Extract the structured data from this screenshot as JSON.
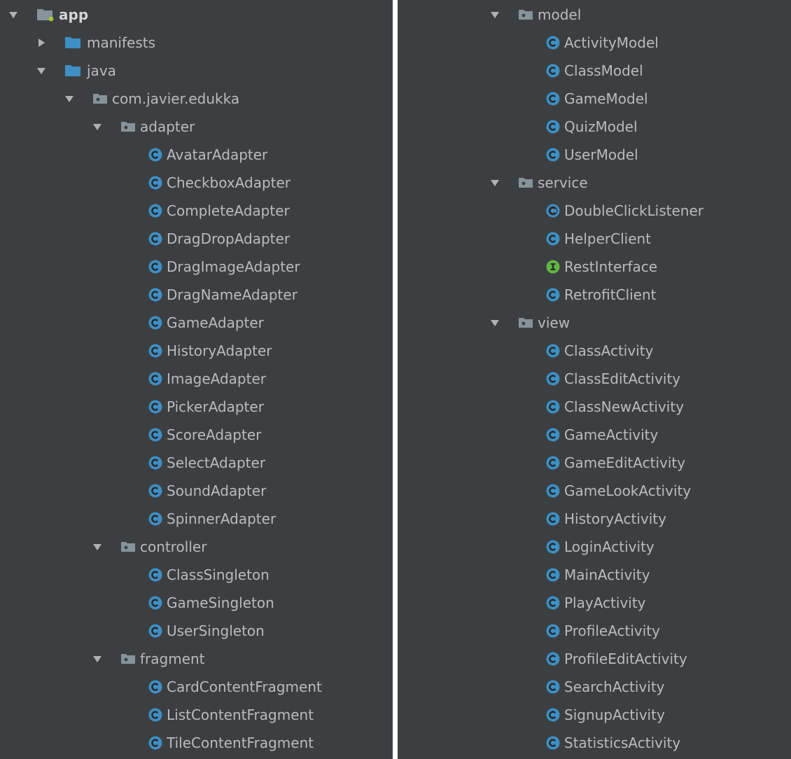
{
  "colors": {
    "background": "#3c3f41",
    "text": "#bbbbbb",
    "folder": "#87939a",
    "source_folder": "#3d8fc6",
    "class_icon": "#3d8fc6",
    "interface_icon": "#62b543",
    "module_dot": "#a4c639",
    "arrow": "#afb1b3"
  },
  "left_tree": [
    {
      "depth": 0,
      "arrow": "down",
      "icon": "module-folder-icon",
      "label": "app",
      "bold": true
    },
    {
      "depth": 1,
      "arrow": "right",
      "icon": "source-folder-icon",
      "label": "manifests"
    },
    {
      "depth": 1,
      "arrow": "down",
      "icon": "source-folder-icon",
      "label": "java"
    },
    {
      "depth": 2,
      "arrow": "down",
      "icon": "package-icon",
      "label": "com.javier.edukka"
    },
    {
      "depth": 3,
      "arrow": "down",
      "icon": "package-icon",
      "label": "adapter"
    },
    {
      "depth": 4,
      "icon": "class-icon",
      "label": "AvatarAdapter"
    },
    {
      "depth": 4,
      "icon": "class-icon",
      "label": "CheckboxAdapter"
    },
    {
      "depth": 4,
      "icon": "class-icon",
      "label": "CompleteAdapter"
    },
    {
      "depth": 4,
      "icon": "class-icon",
      "label": "DragDropAdapter"
    },
    {
      "depth": 4,
      "icon": "class-icon",
      "label": "DragImageAdapter"
    },
    {
      "depth": 4,
      "icon": "class-icon",
      "label": "DragNameAdapter"
    },
    {
      "depth": 4,
      "icon": "class-icon",
      "label": "GameAdapter"
    },
    {
      "depth": 4,
      "icon": "class-icon",
      "label": "HistoryAdapter"
    },
    {
      "depth": 4,
      "icon": "class-icon",
      "label": "ImageAdapter"
    },
    {
      "depth": 4,
      "icon": "class-icon",
      "label": "PickerAdapter"
    },
    {
      "depth": 4,
      "icon": "class-icon",
      "label": "ScoreAdapter"
    },
    {
      "depth": 4,
      "icon": "class-icon",
      "label": "SelectAdapter"
    },
    {
      "depth": 4,
      "icon": "class-icon",
      "label": "SoundAdapter"
    },
    {
      "depth": 4,
      "icon": "class-icon",
      "label": "SpinnerAdapter"
    },
    {
      "depth": 3,
      "arrow": "down",
      "icon": "package-icon",
      "label": "controller"
    },
    {
      "depth": 4,
      "icon": "class-icon",
      "label": "ClassSingleton"
    },
    {
      "depth": 4,
      "icon": "class-icon",
      "label": "GameSingleton"
    },
    {
      "depth": 4,
      "icon": "class-icon",
      "label": "UserSingleton"
    },
    {
      "depth": 3,
      "arrow": "down",
      "icon": "package-icon",
      "label": "fragment"
    },
    {
      "depth": 4,
      "icon": "class-icon",
      "label": "CardContentFragment"
    },
    {
      "depth": 4,
      "icon": "class-icon",
      "label": "ListContentFragment"
    },
    {
      "depth": 4,
      "icon": "class-icon",
      "label": "TileContentFragment"
    }
  ],
  "right_tree": [
    {
      "depth": 3,
      "arrow": "down",
      "icon": "package-icon",
      "label": "model"
    },
    {
      "depth": 4,
      "icon": "class-icon",
      "label": "ActivityModel"
    },
    {
      "depth": 4,
      "icon": "class-icon",
      "label": "ClassModel"
    },
    {
      "depth": 4,
      "icon": "class-icon",
      "label": "GameModel"
    },
    {
      "depth": 4,
      "icon": "class-icon",
      "label": "QuizModel"
    },
    {
      "depth": 4,
      "icon": "class-icon",
      "label": "UserModel"
    },
    {
      "depth": 3,
      "arrow": "down",
      "icon": "package-icon",
      "label": "service"
    },
    {
      "depth": 4,
      "icon": "abstract-class-icon",
      "label": "DoubleClickListener"
    },
    {
      "depth": 4,
      "icon": "class-icon",
      "label": "HelperClient"
    },
    {
      "depth": 4,
      "icon": "interface-icon",
      "label": "RestInterface"
    },
    {
      "depth": 4,
      "icon": "class-icon",
      "label": "RetrofitClient"
    },
    {
      "depth": 3,
      "arrow": "down",
      "icon": "package-icon",
      "label": "view"
    },
    {
      "depth": 4,
      "icon": "class-icon",
      "label": "ClassActivity"
    },
    {
      "depth": 4,
      "icon": "class-icon",
      "label": "ClassEditActivity"
    },
    {
      "depth": 4,
      "icon": "class-icon",
      "label": "ClassNewActivity"
    },
    {
      "depth": 4,
      "icon": "class-icon",
      "label": "GameActivity"
    },
    {
      "depth": 4,
      "icon": "class-icon",
      "label": "GameEditActivity"
    },
    {
      "depth": 4,
      "icon": "class-icon",
      "label": "GameLookActivity"
    },
    {
      "depth": 4,
      "icon": "class-icon",
      "label": "HistoryActivity"
    },
    {
      "depth": 4,
      "icon": "class-icon",
      "label": "LoginActivity"
    },
    {
      "depth": 4,
      "icon": "class-icon",
      "label": "MainActivity"
    },
    {
      "depth": 4,
      "icon": "class-icon",
      "label": "PlayActivity"
    },
    {
      "depth": 4,
      "icon": "class-icon",
      "label": "ProfileActivity"
    },
    {
      "depth": 4,
      "icon": "class-icon",
      "label": "ProfileEditActivity"
    },
    {
      "depth": 4,
      "icon": "class-icon",
      "label": "SearchActivity"
    },
    {
      "depth": 4,
      "icon": "class-icon",
      "label": "SignupActivity"
    },
    {
      "depth": 4,
      "icon": "class-icon",
      "label": "StatisticsActivity"
    }
  ]
}
